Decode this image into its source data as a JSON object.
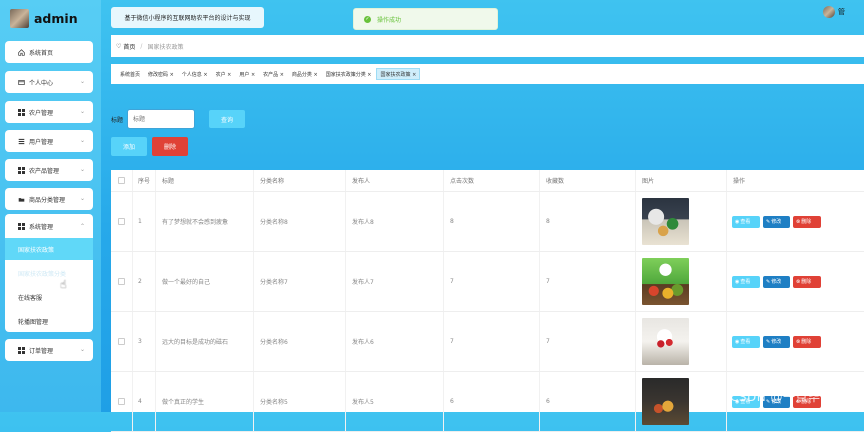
{
  "brand": {
    "name": "admin"
  },
  "sidebar": {
    "items": [
      {
        "label": "系统首页",
        "icon": "home-icon"
      },
      {
        "label": "个人中心",
        "icon": "user-card-icon"
      },
      {
        "label": "农户管理",
        "icon": "grid-icon"
      },
      {
        "label": "用户管理",
        "icon": "list-icon"
      },
      {
        "label": "农产品管理",
        "icon": "grid-icon"
      },
      {
        "label": "商品分类管理",
        "icon": "folder-icon"
      }
    ],
    "open_group": {
      "label": "系统管理",
      "children": [
        "国家扶农政策",
        "国家扶农政策分类",
        "在线客服",
        "轮播图管理"
      ]
    },
    "bottom_item": {
      "label": "订单管理",
      "icon": "grid-icon"
    }
  },
  "header": {
    "title": "基于微信小程序的互联网助农平台的设计与实现",
    "user": "管"
  },
  "toast": {
    "text": "操作成功"
  },
  "breadcrumb": {
    "home": "首页",
    "current": "国家扶农政策"
  },
  "tags": [
    "系统首页",
    "修改密码 ×",
    "个人信息 ×",
    "农户 ×",
    "用户 ×",
    "农产品 ×",
    "商品分类 ×",
    "国家扶农政策分类 ×",
    "国家扶农政策 ×"
  ],
  "search": {
    "label": "标题",
    "placeholder": "标题",
    "button": "查询"
  },
  "actions": {
    "add": "添加",
    "delete": "删除"
  },
  "table": {
    "headers": [
      "",
      "序号",
      "标题",
      "分类名称",
      "发布人",
      "点击次数",
      "收藏数",
      "图片",
      "操作"
    ],
    "rows": [
      {
        "index": "1",
        "title": "有了梦想就不会感到疲惫",
        "category": "分类名称8",
        "publisher": "发布人8",
        "clicks": "8",
        "favorites": "8",
        "image": "vegetables-crate-image"
      },
      {
        "index": "2",
        "title": "做一个最好的自己",
        "category": "分类名称7",
        "publisher": "发布人7",
        "clicks": "7",
        "favorites": "7",
        "image": "farm-produce-poster-image"
      },
      {
        "index": "3",
        "title": "远大的目标是成功的磁石",
        "category": "分类名称6",
        "publisher": "发布人6",
        "clicks": "7",
        "favorites": "7",
        "image": "fruit-box-image"
      },
      {
        "index": "4",
        "title": "做个真正的学生",
        "category": "分类名称5",
        "publisher": "发布人5",
        "clicks": "6",
        "favorites": "6",
        "image": "produce-basket-image"
      }
    ],
    "row_actions": {
      "view": "查看",
      "edit": "修改",
      "delete": "删除"
    }
  },
  "watermark": "CSDN @一点毕设",
  "colors": {
    "primary": "#57d3f9",
    "danger": "#e04136",
    "edit": "#1f7fc4",
    "success": "#67c23a"
  }
}
